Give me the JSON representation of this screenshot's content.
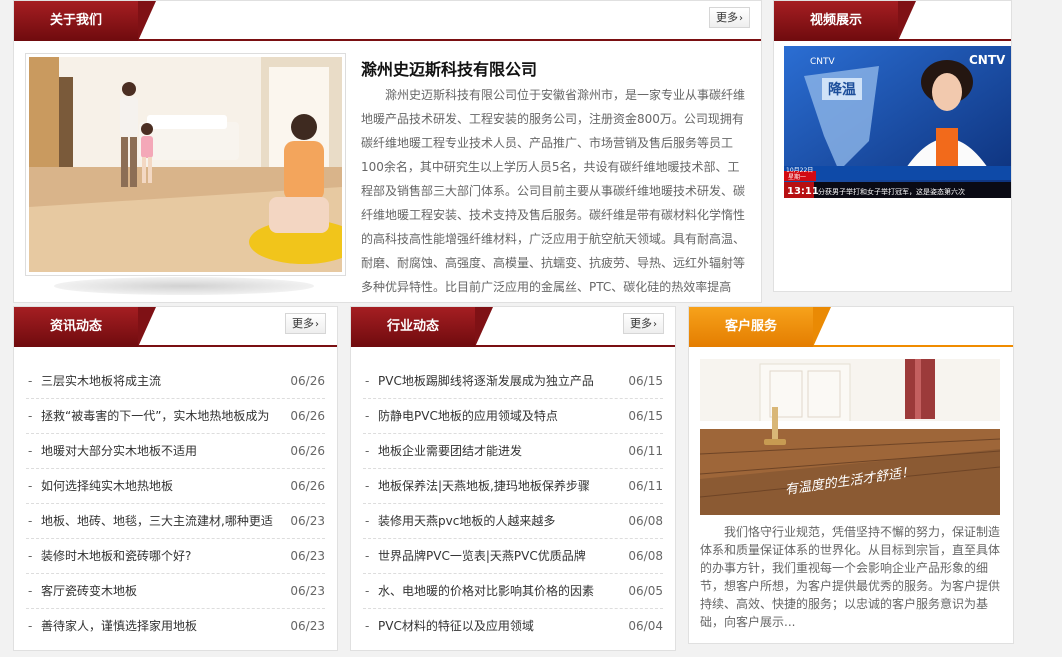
{
  "about": {
    "title": "关于我们",
    "more": "更多",
    "company_name": "滁州史迈斯科技有限公司",
    "text": "滁州史迈斯科技有限公司位于安徽省滁州市，是一家专业从事碳纤维地暖产品技术研发、工程安装的服务公司，注册资金800万。公司现拥有碳纤维地暖工程专业技术人员、产品推广、市场营销及售后服务等员工100余名，其中研究生以上学历人员5名，共设有碳纤维地暖技术部、工程部及销售部三大部门体系。公司目前主要从事碳纤维地暖技术研发、碳纤维地暖工程安装、技术支持及售后服务。碳纤维是带有碳材料化学惰性的高科技高性能增强纤维材料，广泛应用于航空航天领域。具有耐高温、耐磨、耐腐蚀、高强度、高模量、抗蠕变、抗疲劳、导热、远红外辐射等多种优异特性。比目前广泛应用的金属丝、PTC、碳化硅的热效率提高"
  },
  "video": {
    "title": "视频展示",
    "tv": {
      "logo": "CNTV",
      "headline": "降温",
      "date": "10月22日",
      "weekday": "星期一",
      "clock": "13:11",
      "ticker": "分获男子举打和女子举打冠军，这是姿态第六次"
    }
  },
  "news": {
    "title": "资讯动态",
    "more": "更多",
    "items": [
      {
        "title": "三层实木地板将成主流",
        "date": "06/26"
      },
      {
        "title": "拯救“被毒害的下一代”，实木地热地板成为",
        "date": "06/26"
      },
      {
        "title": "地暖对大部分实木地板不适用",
        "date": "06/26"
      },
      {
        "title": "如何选择纯实木地热地板",
        "date": "06/26"
      },
      {
        "title": "地板、地砖、地毯，三大主流建材,哪种更适",
        "date": "06/23"
      },
      {
        "title": "装修时木地板和瓷砖哪个好?",
        "date": "06/23"
      },
      {
        "title": "客厅瓷砖变木地板",
        "date": "06/23"
      },
      {
        "title": "善待家人，谨慎选择家用地板",
        "date": "06/23"
      }
    ]
  },
  "industry": {
    "title": "行业动态",
    "more": "更多",
    "items": [
      {
        "title": "PVC地板踢脚线将逐渐发展成为独立产品",
        "date": "06/15"
      },
      {
        "title": "防静电PVC地板的应用领域及特点",
        "date": "06/15"
      },
      {
        "title": "地板企业需要团结才能进发",
        "date": "06/11"
      },
      {
        "title": "地板保养法|天燕地板,捷玛地板保养步骤",
        "date": "06/11"
      },
      {
        "title": "装修用天燕pvc地板的人越来越多",
        "date": "06/08"
      },
      {
        "title": "世界品牌PVC一览表|天燕PVC优质品牌",
        "date": "06/08"
      },
      {
        "title": "水、电地暖的价格对比影响其价格的因素",
        "date": "06/05"
      },
      {
        "title": "PVC材料的特征以及应用领域",
        "date": "06/04"
      }
    ]
  },
  "service": {
    "title": "客户服务",
    "photo_slogan": "有温度的生活才舒适！",
    "text": "我们恪守行业规范，凭借坚持不懈的努力，保证制造体系和质量保证体系的世界化。从目标到宗旨，直至具体的办事方针，我们重视每一个会影响企业产品形象的细节，想客户所想，为客户提供最优秀的服务。为客户提供持续、高效、快捷的服务；以忠诚的客户服务意识为基础，向客户展示..."
  },
  "colors": {
    "header_red": "#7a0f12",
    "service_orange": "#f08c00"
  },
  "icons": {
    "more": "chevron-right-icon"
  }
}
